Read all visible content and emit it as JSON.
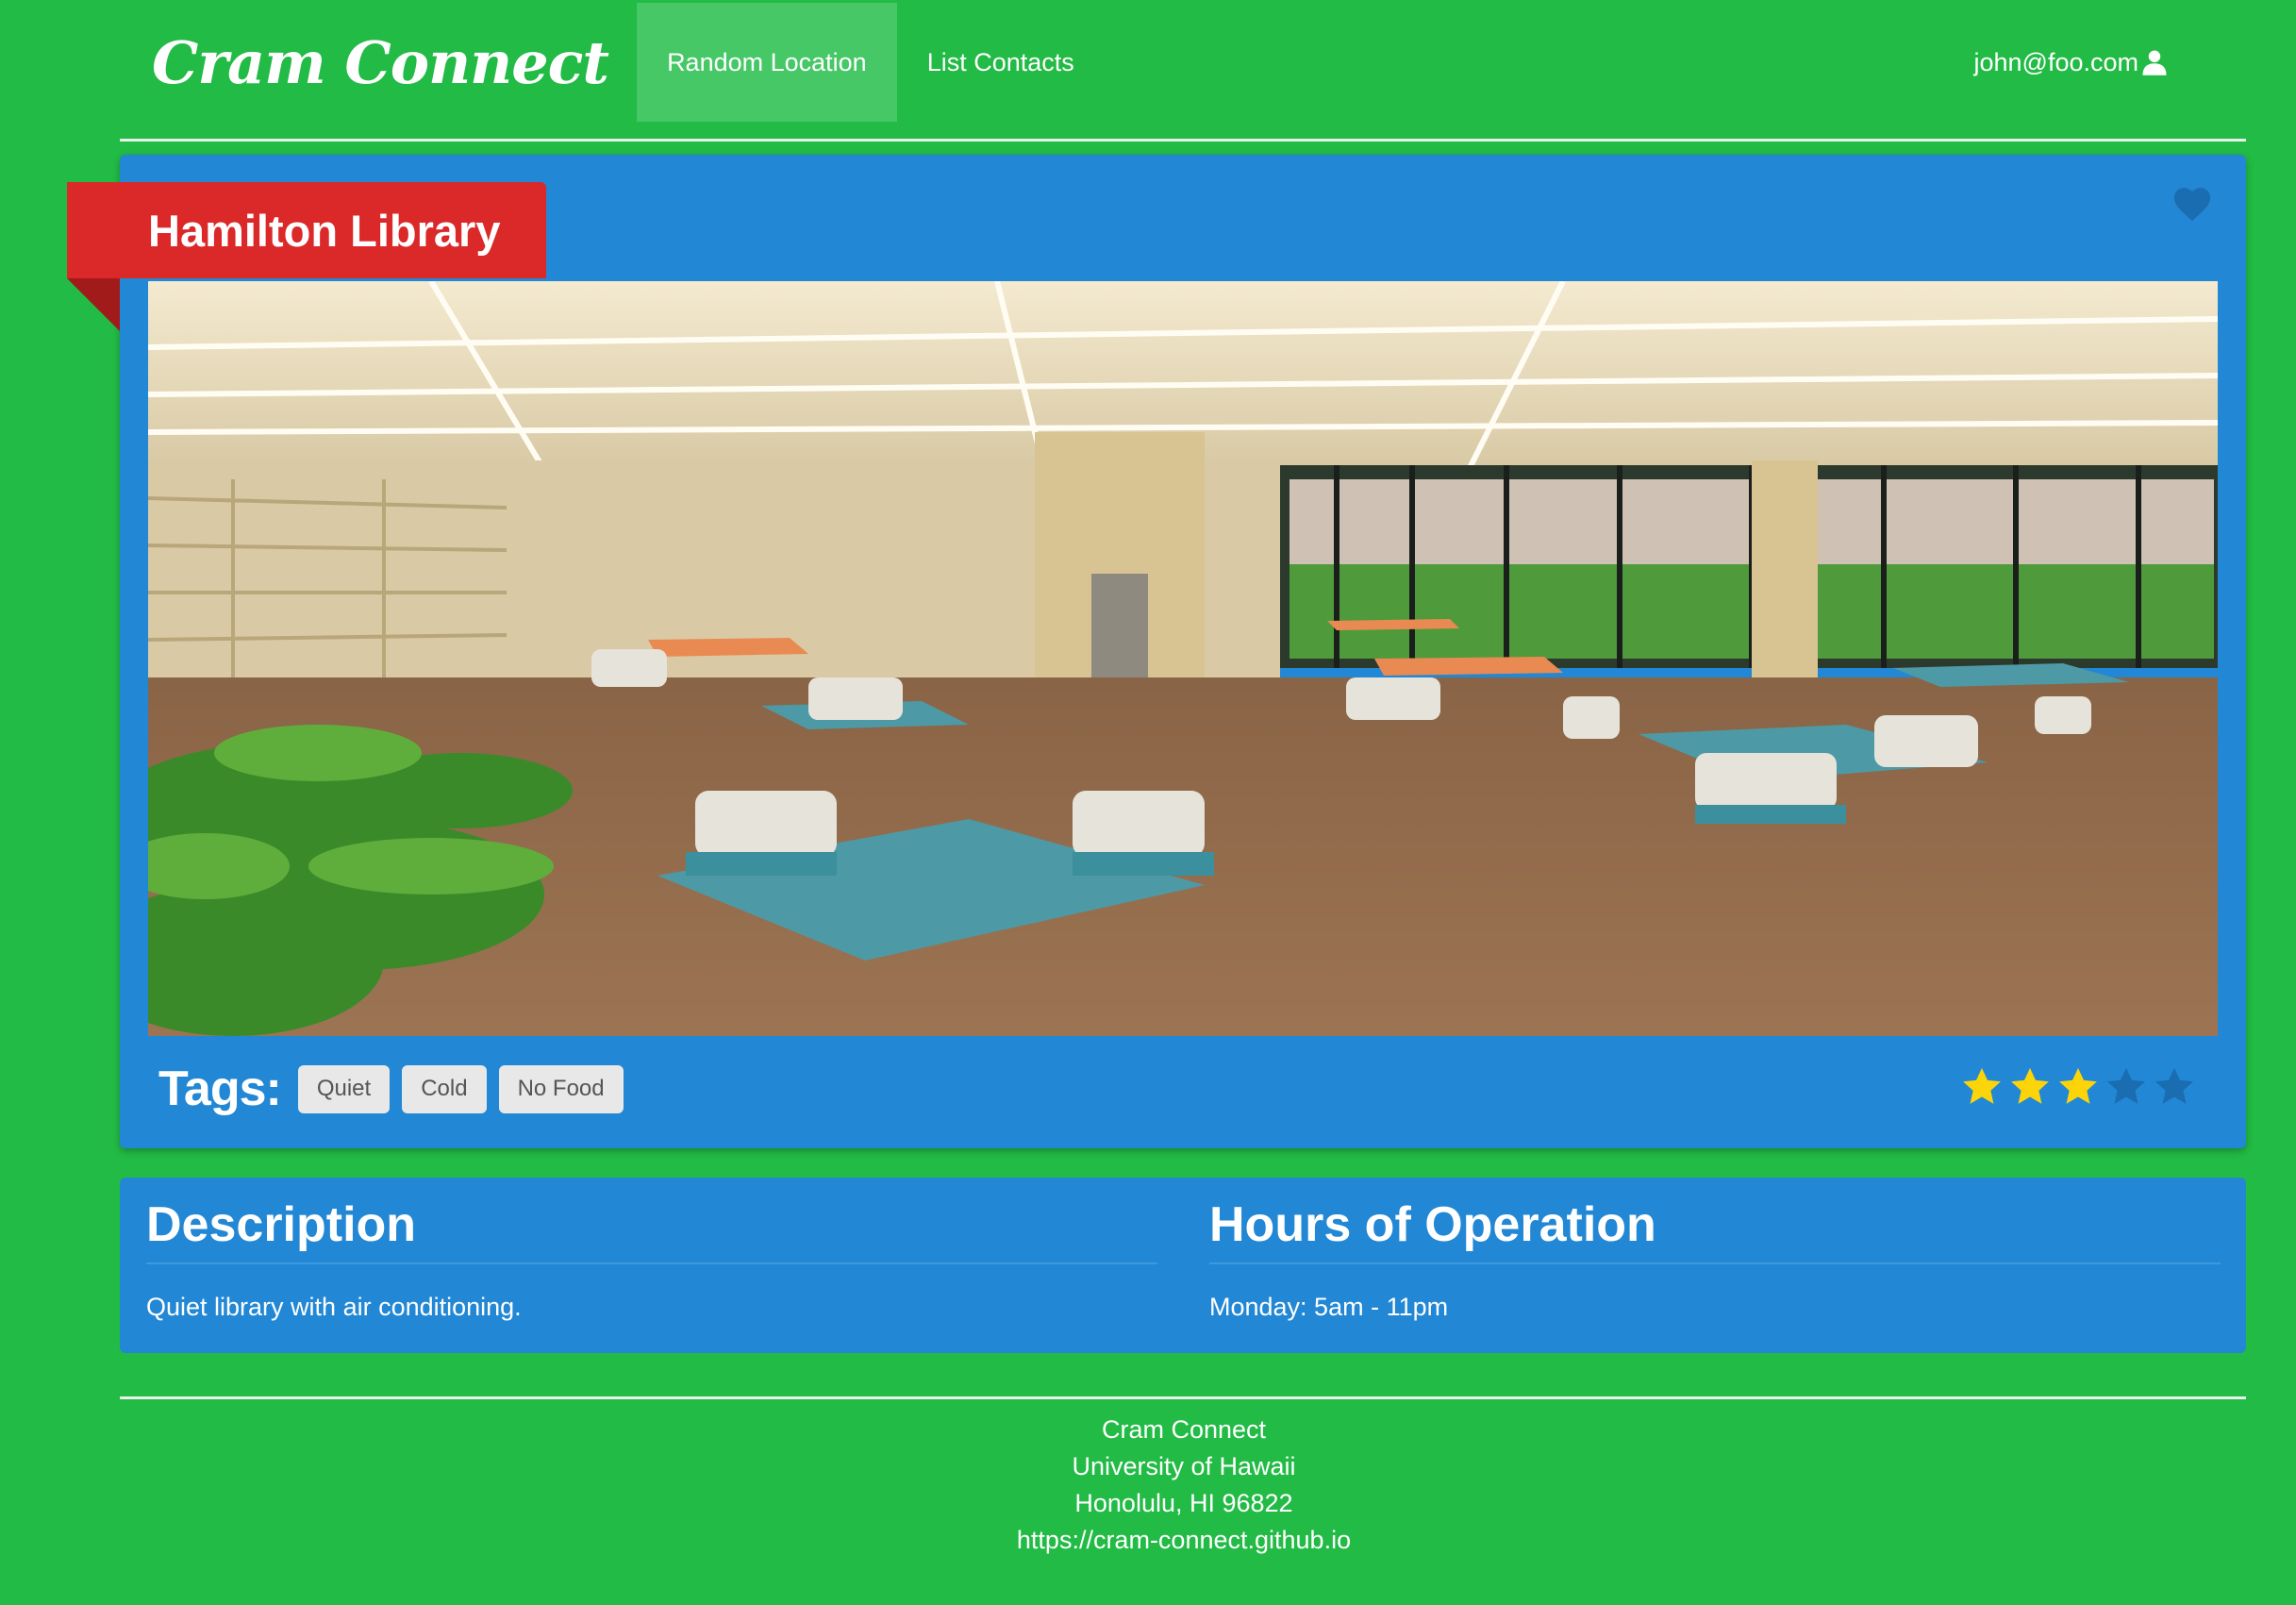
{
  "navbar": {
    "brand": "Cram Connect",
    "items": [
      {
        "label": "Random Location",
        "active": true
      },
      {
        "label": "List Contacts",
        "active": false
      }
    ],
    "user_email": "john@foo.com",
    "user_icon": "user-icon"
  },
  "location": {
    "name": "Hamilton Library",
    "favorite_icon": "heart-icon",
    "photo": "study-room-photo",
    "tags_label": "Tags:",
    "tags": [
      "Quiet",
      "Cold",
      "No Food"
    ],
    "rating": {
      "value": 3,
      "max": 5
    }
  },
  "description": {
    "title": "Description",
    "text": "Quiet library with air conditioning."
  },
  "hours": {
    "title": "Hours of Operation",
    "text": "Monday: 5am - 11pm"
  },
  "footer": {
    "line1": "Cram Connect",
    "line2": "University of Hawaii",
    "line3": "Honolulu, HI 96822",
    "line4": "https://cram-connect.github.io"
  },
  "colors": {
    "background": "#22bb45",
    "card": "#2287d4",
    "ribbon": "#db2828",
    "star_filled": "#fbd40a",
    "star_empty": "#1a6db0"
  }
}
